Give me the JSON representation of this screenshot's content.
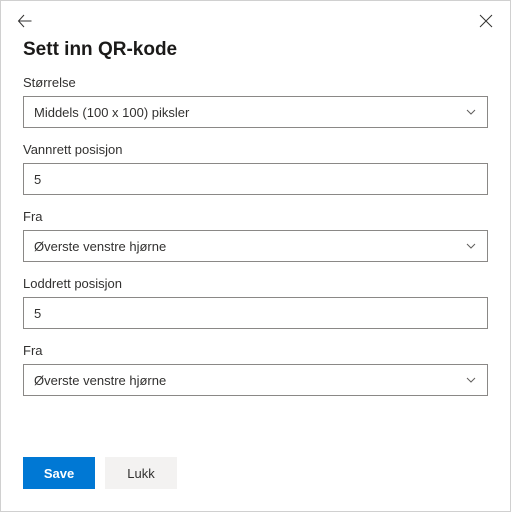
{
  "header": {
    "title": "Sett inn QR-kode"
  },
  "fields": {
    "size": {
      "label": "Størrelse",
      "value": "Middels (100 x 100) piksler"
    },
    "hpos": {
      "label": "Vannrett posisjon",
      "value": "5"
    },
    "hfrom": {
      "label": "Fra",
      "value": "Øverste venstre hjørne"
    },
    "vpos": {
      "label": "Loddrett posisjon",
      "value": "5"
    },
    "vfrom": {
      "label": "Fra",
      "value": "Øverste venstre hjørne"
    }
  },
  "footer": {
    "save": "Save",
    "close": "Lukk"
  }
}
